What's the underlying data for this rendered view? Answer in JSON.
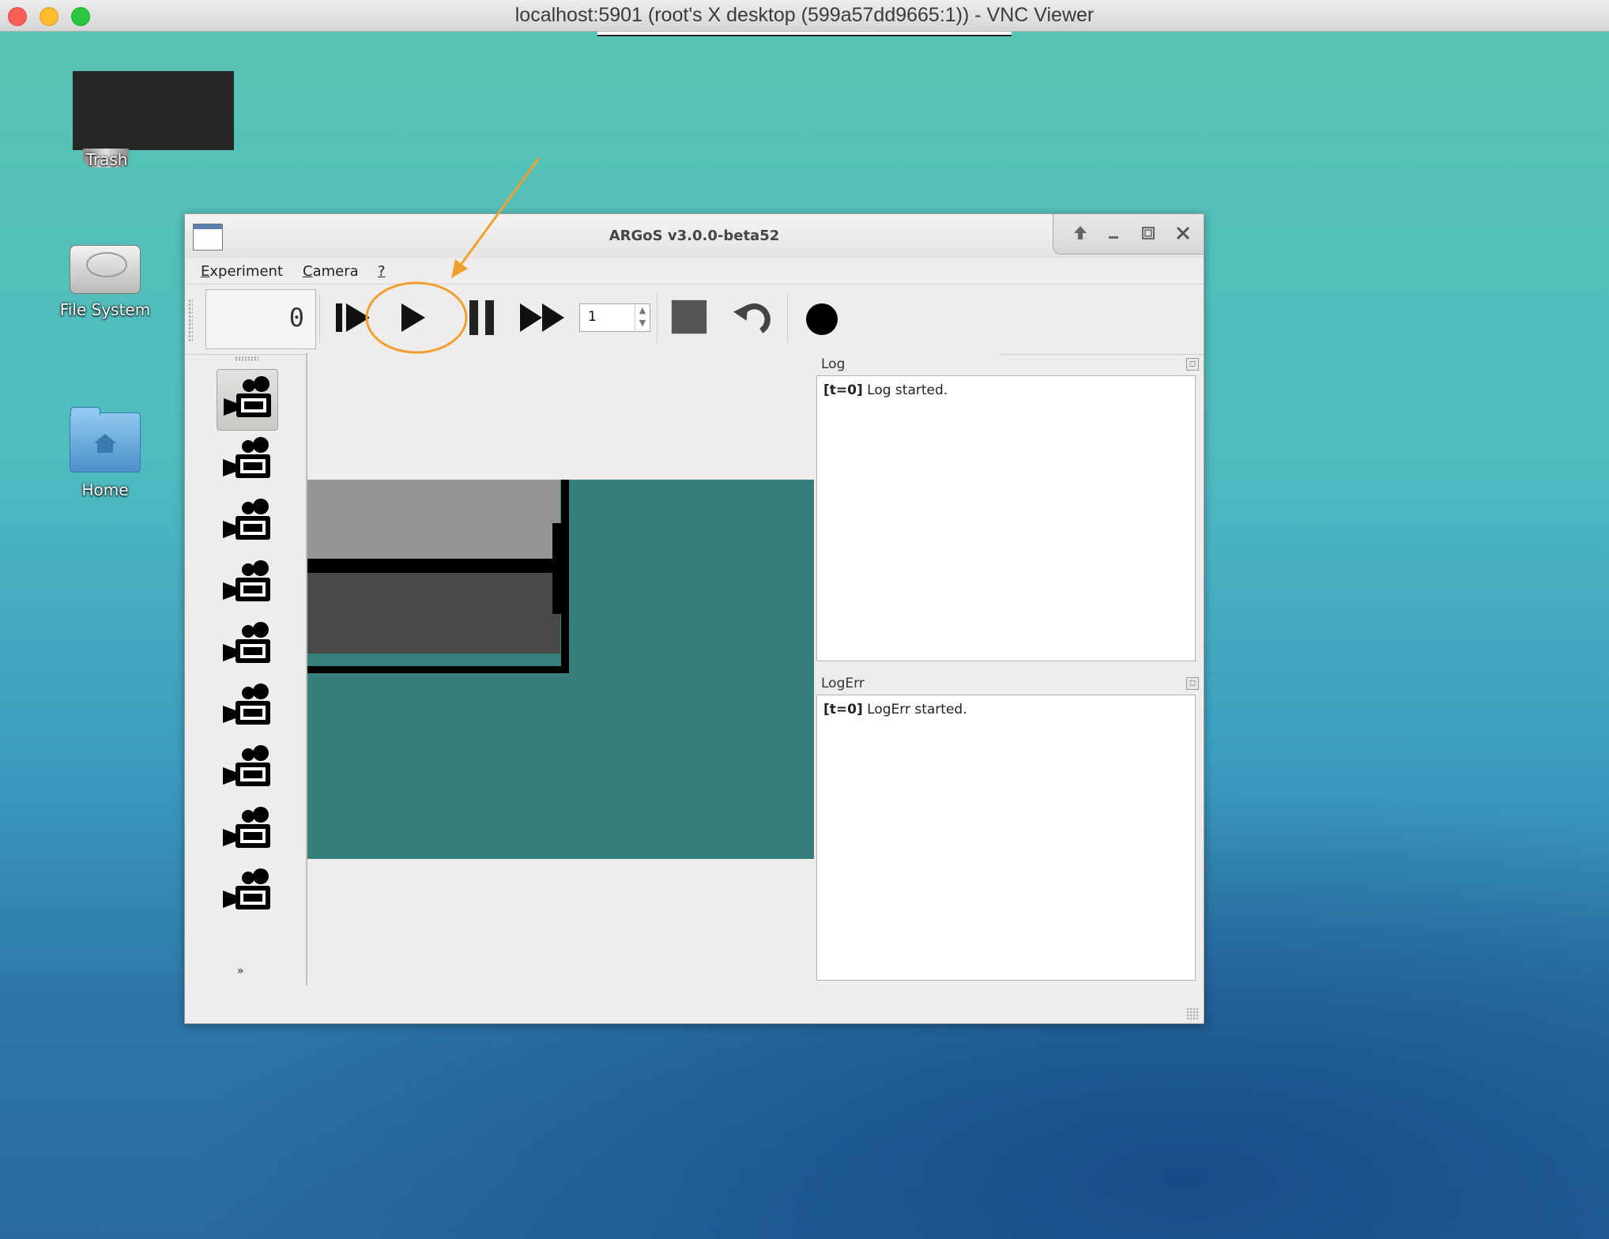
{
  "vnc": {
    "title": "localhost:5901 (root's X desktop (599a57dd9665:1)) - VNC Viewer"
  },
  "desktop": {
    "icons": [
      {
        "label": "Trash",
        "icon": "trash-icon"
      },
      {
        "label": "File System",
        "icon": "hard-drive-icon"
      },
      {
        "label": "Home",
        "icon": "home-folder-icon"
      }
    ]
  },
  "window": {
    "title": "ARGoS v3.0.0-beta52",
    "menu": {
      "experiment": {
        "first": "E",
        "rest": "xperiment"
      },
      "camera": {
        "first": "C",
        "rest": "amera"
      },
      "help": "?"
    },
    "toolbar": {
      "step_counter": "0",
      "speed": "1",
      "buttons": [
        "step-icon",
        "play-icon",
        "pause-icon",
        "fast-forward-icon",
        "stop-icon",
        "reset-icon",
        "record-icon"
      ]
    },
    "camera_count": 9,
    "log": {
      "title": "Log",
      "prefix": "[t=0]",
      "message": "Log started."
    },
    "logerr": {
      "title": "LogErr",
      "prefix": "[t=0]",
      "message": "LogErr started."
    }
  },
  "colors": {
    "annotation": "#f0a030",
    "arena": "#367f7d",
    "wall_light": "#959595",
    "wall_dark": "#494949"
  }
}
